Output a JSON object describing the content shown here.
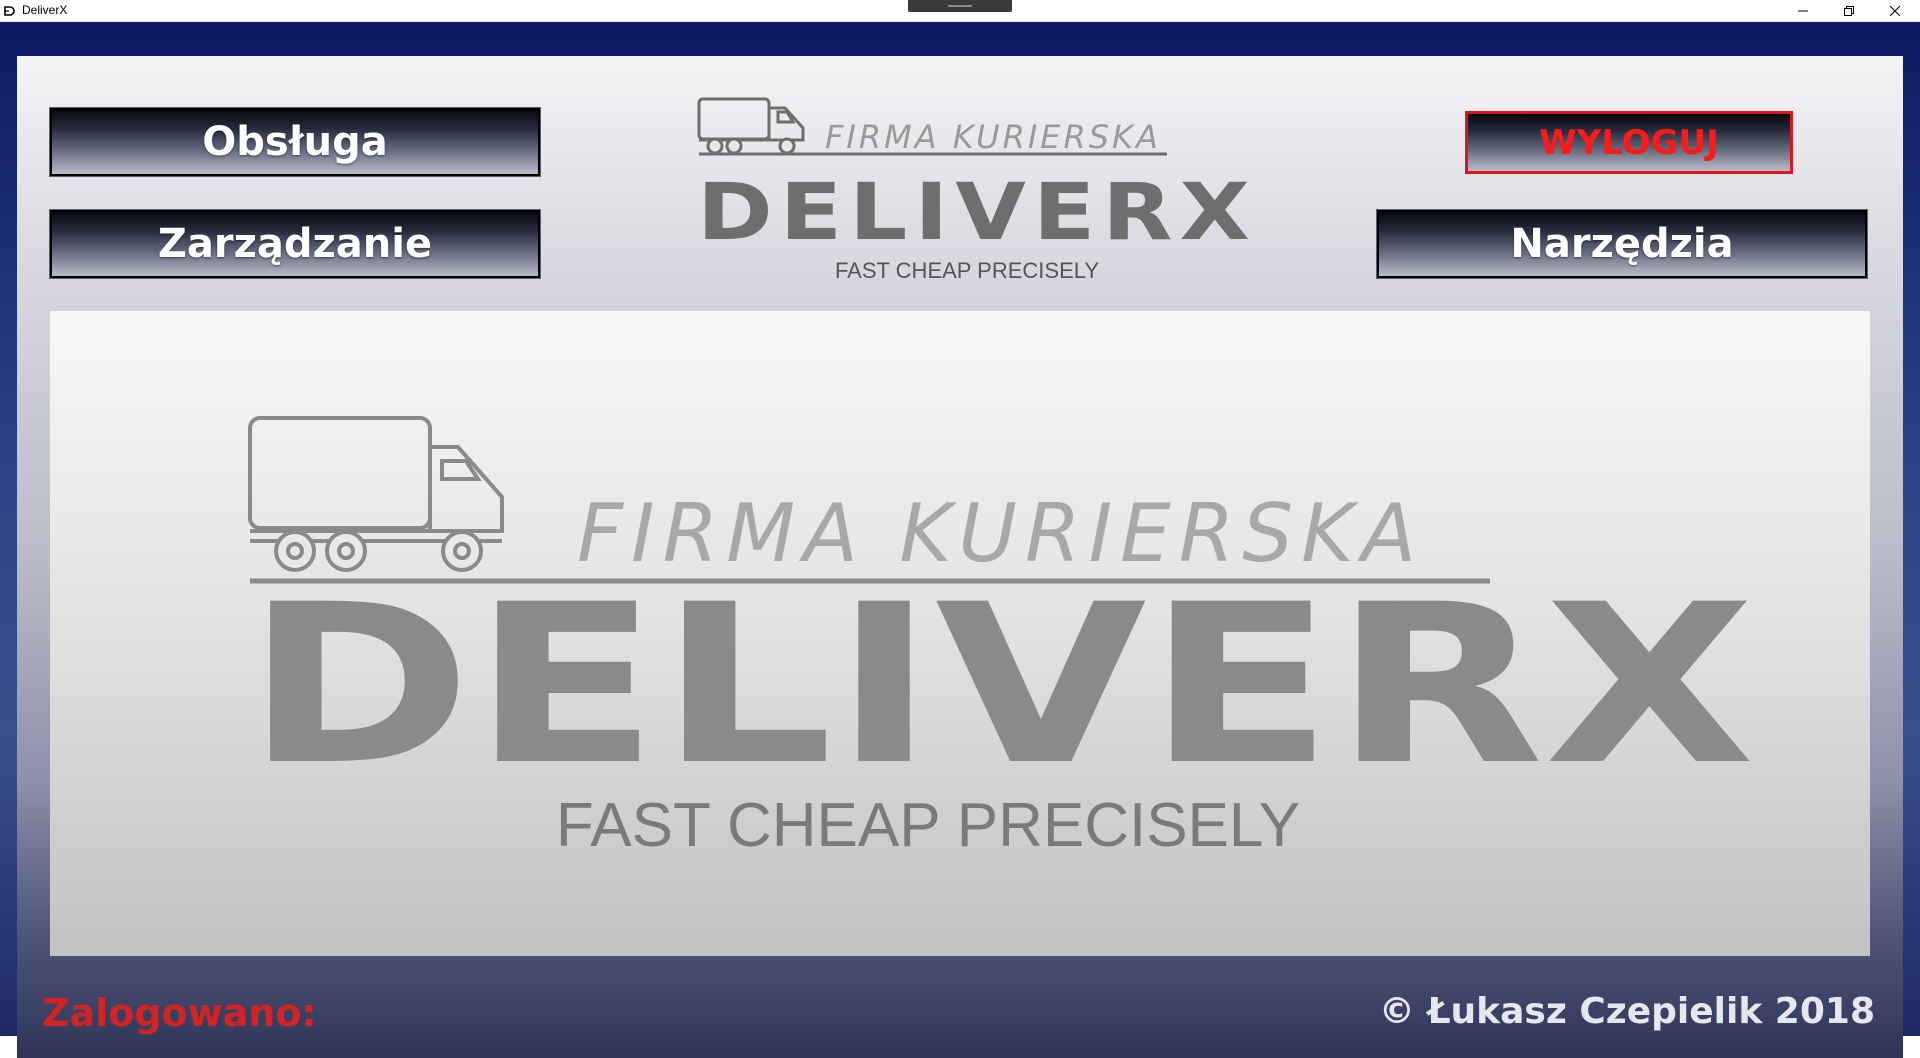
{
  "window": {
    "title": "DeliverX"
  },
  "menu": {
    "obsluga": "Obsługa",
    "zarzadzanie": "Zarządzanie",
    "wyloguj": "WYLOGUJ",
    "narzedzia": "Narzędzia"
  },
  "logo": {
    "company_type": "FIRMA KURIERSKA",
    "brand": "DELIVERX",
    "tagline": "FAST CHEAP PRECISELY"
  },
  "footer": {
    "status_label": "Zalogowano:",
    "copyright": "© Łukasz Czepielik 2018"
  },
  "colors": {
    "accent_red": "#e0141e",
    "logo_gray": "#7a7a7a"
  },
  "icons": {
    "app": "delivery-d-icon",
    "truck": "delivery-truck-icon"
  }
}
